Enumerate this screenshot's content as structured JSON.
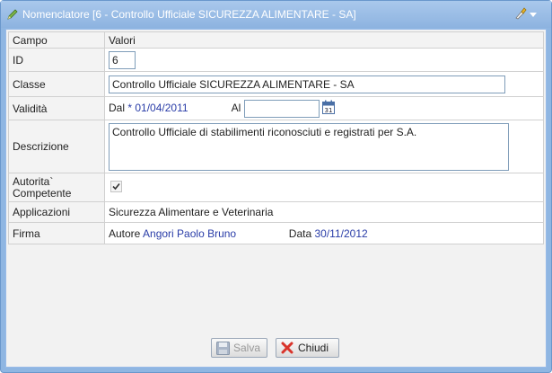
{
  "window": {
    "title": "Nomenclatore [6 - Controllo Ufficiale SICUREZZA ALIMENTARE - SA]"
  },
  "grid": {
    "header": {
      "col1": "Campo",
      "col2": "Valori"
    },
    "id": {
      "label": "ID",
      "value": "6"
    },
    "classe": {
      "label": "Classe",
      "value": "Controllo Ufficiale SICUREZZA ALIMENTARE - SA"
    },
    "validita": {
      "label": "Validità",
      "dal_label": "Dal",
      "required_mark": "*",
      "dal_value": "01/04/2011",
      "al_label": "Al",
      "al_value": "",
      "calendar_icon": "calendar-icon"
    },
    "descrizione": {
      "label": "Descrizione",
      "value": "Controllo Ufficiale di stabilimenti riconosciuti e registrati per S.A."
    },
    "autorita": {
      "label": "Autorita` Competente",
      "checked": true
    },
    "applicazioni": {
      "label": "Applicazioni",
      "value": "Sicurezza Alimentare e Veterinaria"
    },
    "firma": {
      "label": "Firma",
      "autore_label": "Autore",
      "autore_value": "Angori Paolo Bruno",
      "data_label": "Data",
      "data_value": "30/11/2012"
    }
  },
  "buttons": {
    "save": {
      "label": "Salva",
      "enabled": false,
      "icon": "floppy-disk-icon"
    },
    "close": {
      "label": "Chiudi",
      "enabled": true,
      "icon": "red-x-icon"
    }
  },
  "colors": {
    "title_bar": "#8db3e0",
    "link_blue": "#2a3da8",
    "close_red": "#d9342b"
  }
}
